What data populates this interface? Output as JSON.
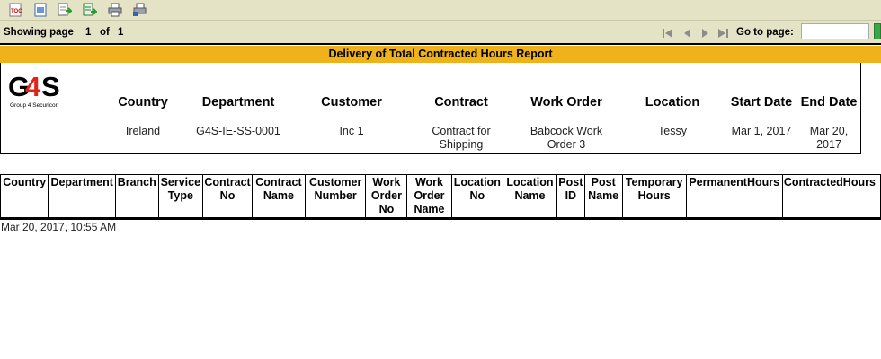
{
  "toolbar": {
    "icons": [
      "toc-icon",
      "export-icon",
      "export-data-icon",
      "export-excel-icon",
      "print-icon",
      "print-server-icon"
    ]
  },
  "pager": {
    "showing_label": "Showing page",
    "current_page": "1",
    "of_label": "of",
    "total_pages": "1",
    "goto_label": "Go to page:",
    "goto_value": ""
  },
  "report": {
    "title": "Delivery of Total Contracted Hours Report",
    "logo_text": "G4S",
    "logo_subtext": "Group 4 Securicor",
    "headers": {
      "country": {
        "label": "Country",
        "value": "Ireland"
      },
      "department": {
        "label": "Department",
        "value": "G4S-IE-SS-0001"
      },
      "customer": {
        "label": "Customer",
        "value": "Inc 1"
      },
      "contract": {
        "label": "Contract",
        "value": "Contract for Shipping"
      },
      "work_order": {
        "label": "Work Order",
        "value": "Babcock Work Order 3"
      },
      "location": {
        "label": "Location",
        "value": "Tessy"
      },
      "start_date": {
        "label": "Start Date",
        "value": "Mar 1, 2017"
      },
      "end_date": {
        "label": "End Date",
        "value": "Mar 20, 2017"
      }
    },
    "columns": [
      "Country",
      "Department",
      "Branch",
      "Service Type",
      "Contract No",
      "Contract Name",
      "Customer Number",
      "Work Order No",
      "Work Order Name",
      "Location No",
      "Location Name",
      "Post ID",
      "Post Name",
      "Temporary Hours",
      "PermanentHours",
      "ContractedHours"
    ],
    "generated": "Mar 20, 2017, 10:55 AM"
  },
  "colors": {
    "toolbar_bg": "#e4e3c6",
    "title_bar": "#f0b21b",
    "logo_red": "#e2231a"
  }
}
